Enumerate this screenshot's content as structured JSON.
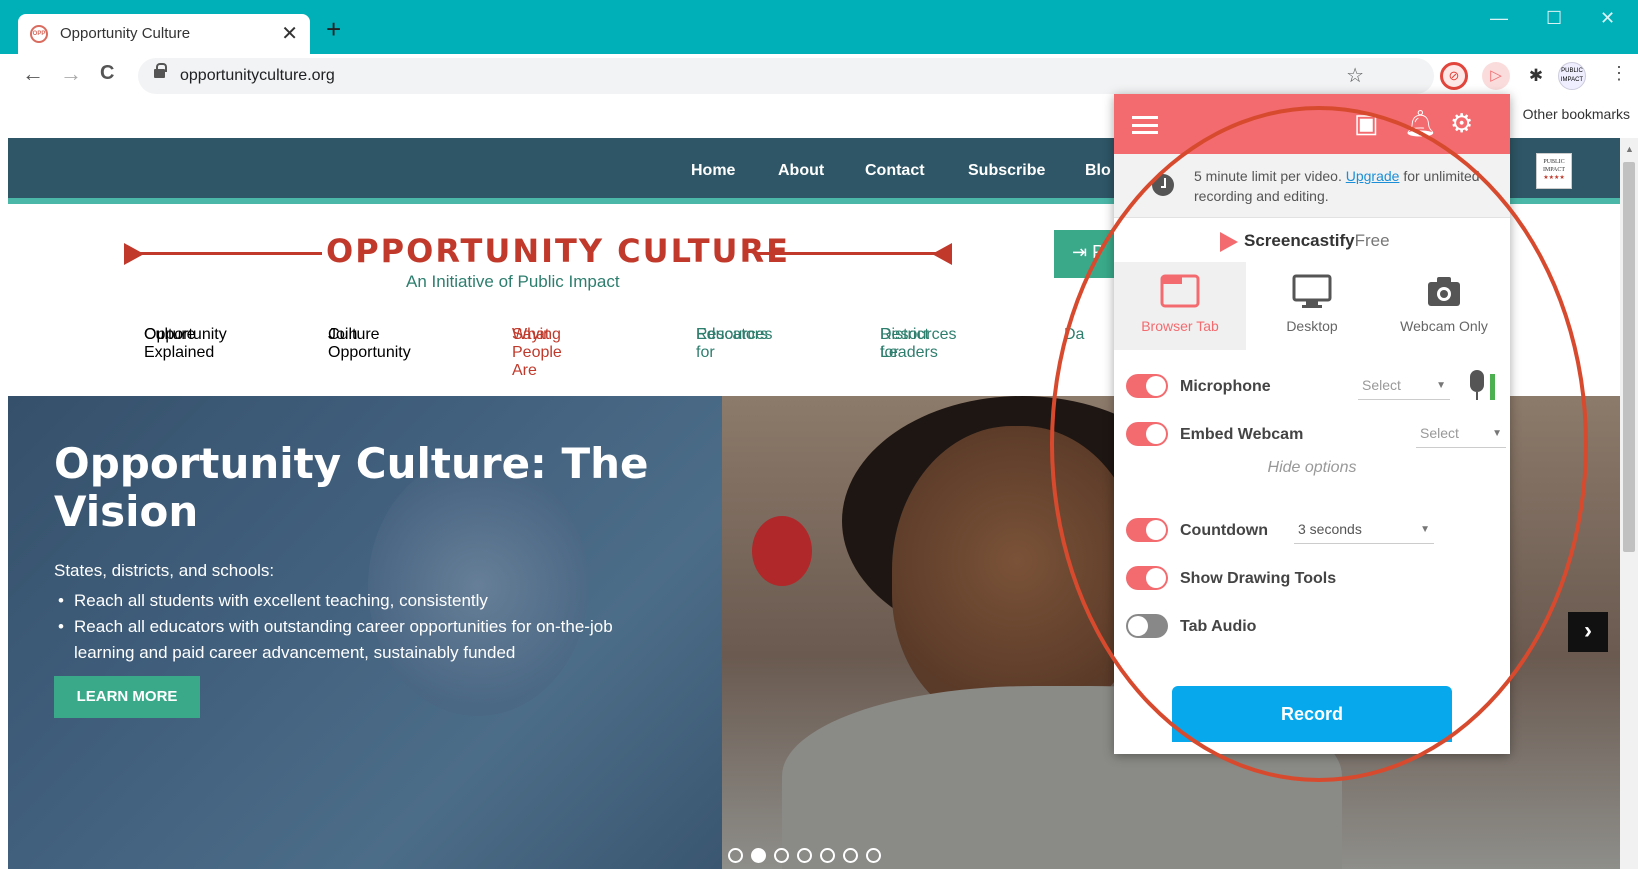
{
  "browser": {
    "tab_title": "Opportunity Culture",
    "tab_close": "✕",
    "new_tab": "+",
    "back": "←",
    "forward": "→",
    "reload": "C",
    "url": "opportunityculture.org",
    "star": "☆",
    "menu": "⋮",
    "other_bookmarks": "Other bookmarks",
    "window_controls": [
      "—",
      "☐",
      "✕"
    ],
    "favicon_text": "OPP"
  },
  "site_nav": {
    "items": [
      "Home",
      "About",
      "Contact",
      "Subscribe",
      "Blo"
    ],
    "logo_text": [
      "PUBLIC",
      "IMPACT",
      "★★★★"
    ],
    "cta_partial": "P"
  },
  "brand": {
    "title": "OPPORTUNITY CULTURE",
    "subtitle": "An Initiative of Public Impact",
    "accent_color": "#c0392b",
    "teal_color": "#2e7e6e"
  },
  "subnav": [
    {
      "label_1": "Opportunity",
      "label_2": "Culture Explained",
      "color": "#222222"
    },
    {
      "label_1": "Join Opportunity",
      "label_2": "Culture",
      "color": "#222222"
    },
    {
      "label_1": "What People Are",
      "label_2": "Saying",
      "color": "#c0392b"
    },
    {
      "label_1": "Resources for",
      "label_2": "Educators",
      "color": "#2e7e6e"
    },
    {
      "label_1": "Resources for",
      "label_2": "District Leaders",
      "color": "#2e7e6e"
    },
    {
      "label_1": "Da",
      "label_2": "",
      "color": "#2e7e6e"
    }
  ],
  "hero": {
    "heading": "Opportunity Culture: The Vision",
    "intro": "States, districts, and schools:",
    "bullets": [
      "Reach all students with excellent teaching, consistently",
      "Reach all educators with outstanding career opportunities for on-the-job learning and paid career advancement, sustainably funded"
    ],
    "cta": "LEARN MORE",
    "next": "›",
    "slide_count": 7,
    "active_slide": 2
  },
  "screencastify": {
    "note_text": "5 minute limit per video. ",
    "note_link": "Upgrade",
    "note_rest": " for unlimited recording and editing.",
    "brand_name": "Screencastify",
    "brand_tier": "Free",
    "modes": [
      "Browser Tab",
      "Desktop",
      "Webcam Only"
    ],
    "selected_mode": "Browser Tab",
    "options": {
      "microphone": {
        "label": "Microphone",
        "on": true,
        "select": "Select"
      },
      "webcam": {
        "label": "Embed Webcam",
        "on": true,
        "select": "Select"
      },
      "hide_options": "Hide options",
      "countdown": {
        "label": "Countdown",
        "on": true,
        "select": "3 seconds"
      },
      "drawing": {
        "label": "Show Drawing Tools",
        "on": true
      },
      "tab_audio": {
        "label": "Tab Audio",
        "on": false
      }
    },
    "record": "Record",
    "header_color": "#f36b6f",
    "record_color": "#07a8ec"
  },
  "annotation_color": "#d84a2e"
}
